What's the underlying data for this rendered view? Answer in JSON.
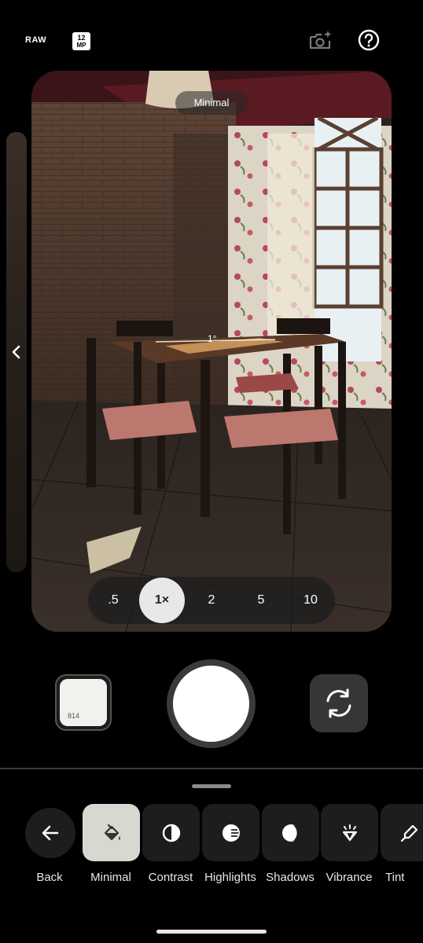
{
  "top_bar": {
    "raw_label": "RAW",
    "mp_line1": "12",
    "mp_line2": "MP",
    "icons": [
      "camera-sparkle-icon",
      "help-icon"
    ]
  },
  "viewfinder": {
    "mode_label": "Minimal",
    "level_label": "1°",
    "scene": "dining room with wooden table and chairs"
  },
  "zoom": {
    "options": [
      ".5",
      "1×",
      "2",
      "5",
      "10"
    ],
    "selected": "1×"
  },
  "controls": {
    "thumbnail_count": "814",
    "icons": [
      "shutter-button",
      "flip-camera-icon"
    ]
  },
  "tools": [
    {
      "label": "Back",
      "icon": "arrow-left-icon"
    },
    {
      "label": "Minimal",
      "icon": "paint-bucket-icon"
    },
    {
      "label": "Contrast",
      "icon": "contrast-icon"
    },
    {
      "label": "Highlights",
      "icon": "highlights-icon"
    },
    {
      "label": "Shadows",
      "icon": "shadows-icon"
    },
    {
      "label": "Vibrance",
      "icon": "vibrance-icon"
    },
    {
      "label": "Tint",
      "icon": "eyedropper-icon"
    }
  ],
  "colors": {
    "background": "#000000",
    "selected_tool": "#d8d8d0",
    "tool_bg": "#1d1d1d"
  }
}
